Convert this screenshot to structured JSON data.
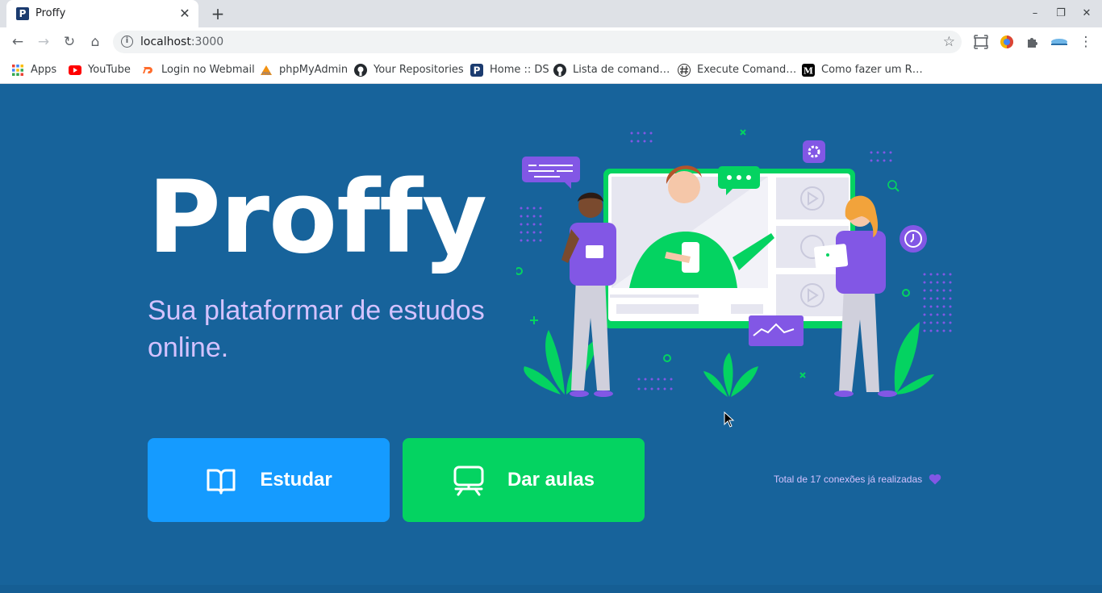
{
  "browser": {
    "tab_title": "Proffy",
    "tab_favicon_letter": "P",
    "close_tab": "✕",
    "new_tab": "+",
    "url_host": "localhost",
    "url_port": ":3000",
    "window_controls": {
      "minimize": "–",
      "restore": "❐",
      "close": "✕"
    }
  },
  "bookmarks": [
    {
      "label": "Apps",
      "icon": "apps-grid-icon"
    },
    {
      "label": "YouTube",
      "icon": "youtube-icon"
    },
    {
      "label": "Login no Webmail",
      "icon": "cpanel-icon"
    },
    {
      "label": "phpMyAdmin",
      "icon": "phpmyadmin-icon"
    },
    {
      "label": "Your Repositories",
      "icon": "github-icon"
    },
    {
      "label": "Home :: DS",
      "icon": "ds-icon"
    },
    {
      "label": "Lista de comand…",
      "icon": "github-icon"
    },
    {
      "label": "Execute Comand…",
      "icon": "hash-icon"
    },
    {
      "label": "Como fazer um R…",
      "icon": "medium-icon"
    }
  ],
  "page": {
    "logo": "Proffy",
    "tagline": "Sua plataformar de estudos online.",
    "study_button": "Estudar",
    "teach_button": "Dar aulas",
    "connections": "Total de 17 conexões já realizadas"
  },
  "colors": {
    "background": "#17639b",
    "study": "#159bff",
    "teach": "#04d361",
    "purple": "#8257e5",
    "tagline": "#d4c2ff"
  }
}
